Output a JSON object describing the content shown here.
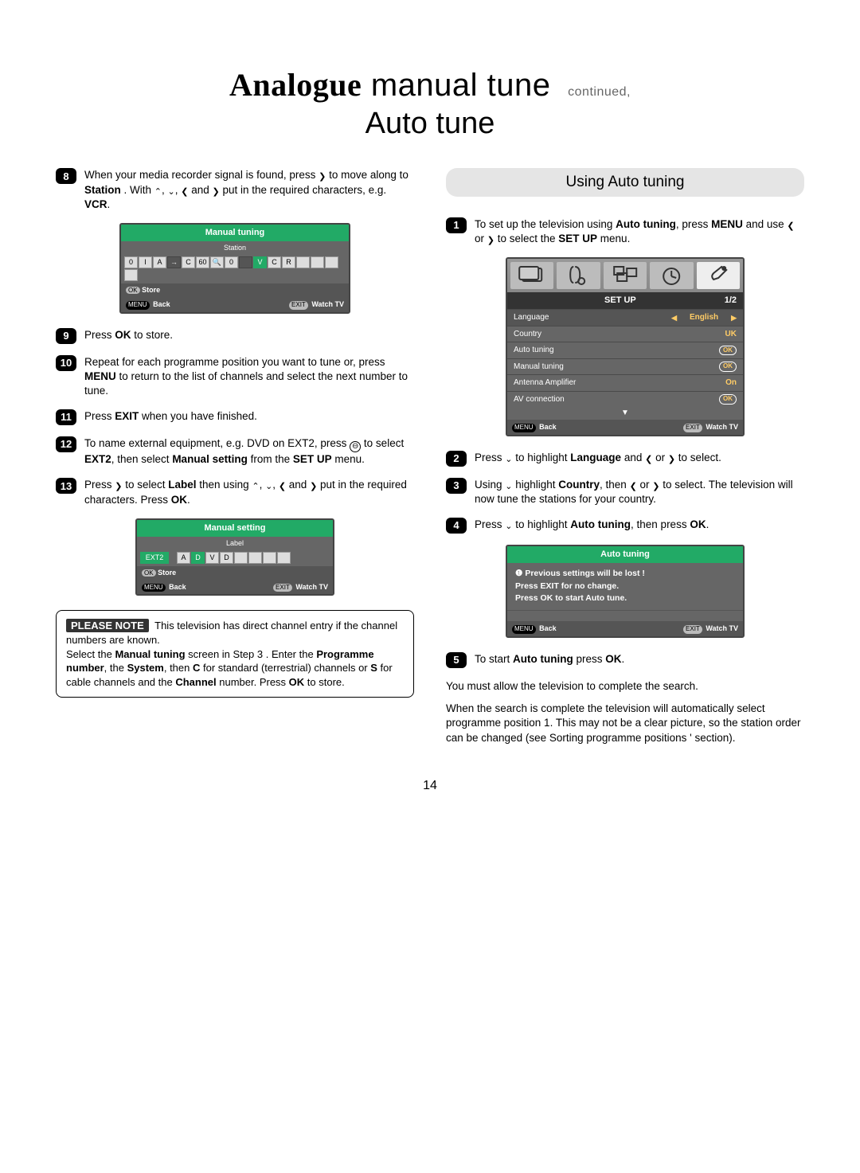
{
  "title": {
    "strong": "Analogue",
    "rest": " manual tune",
    "continued": "continued,",
    "line2": "Auto tune"
  },
  "left": {
    "step8": {
      "num": "8",
      "text_a": "When your media recorder signal is found, press ",
      "text_b": " to move along to ",
      "station": "Station",
      "text_c": ". With ",
      "text_d": " and ",
      "text_e": " put in the required characters,  e.g. ",
      "vcr": "VCR",
      "period": "."
    },
    "osd1": {
      "title": "Manual tuning",
      "sub": "Station",
      "cells": [
        "0",
        "I",
        "A",
        "→",
        "C",
        "60",
        "🔍",
        "0",
        "",
        "V",
        "C",
        "R",
        "",
        "",
        "",
        ""
      ],
      "store": "Store",
      "ok": "OK",
      "menu": "MENU",
      "back": "Back",
      "exit": "EXIT",
      "watch": "Watch TV"
    },
    "step9": {
      "num": "9",
      "a": "Press ",
      "b": "OK",
      "c": " to store."
    },
    "step10": {
      "num": "10",
      "a": "Repeat for each  programme position    you want to tune or, press ",
      "b": "MENU",
      "c": " to return to the list of channels and select the next number to tune."
    },
    "step11": {
      "num": "11",
      "a": "Press ",
      "b": "EXIT",
      "c": " when you have finished."
    },
    "step12": {
      "num": "12",
      "a": "To name external equipment,  e.g. DVD on EXT2, press ",
      "b": " to select ",
      "c": "EXT2",
      "d": ", then select ",
      "e": "Manual setting",
      "f": " from the ",
      "g": "SET UP",
      "h": " menu."
    },
    "step13": {
      "num": "13",
      "a": "Press ",
      "b": " to select ",
      "c": "Label",
      "d": " then using ",
      "e": " and ",
      "f": " put in the required characters. Press ",
      "g": "OK",
      "h": "."
    },
    "osd2": {
      "title": "Manual setting",
      "sub": "Label",
      "ext": "EXT2",
      "cells": [
        "A",
        "D",
        "V",
        "D",
        "",
        "",
        "",
        ""
      ],
      "ok": "OK",
      "store": "Store",
      "menu": "MENU",
      "back": "Back",
      "exit": "EXIT",
      "watch": "Watch TV"
    },
    "note": {
      "badge": "PLEASE NOTE",
      "a": "This television has direct channel entry if the channel numbers are known.",
      "b1": "Select the ",
      "b2": "Manual tuning",
      "b3": " screen in Step 3 . Enter the ",
      "c1": "Programme number",
      "c2": ", the ",
      "c3": "System",
      "c4": ", then ",
      "c5": "C",
      "c6": " for standard (terrestrial) channels or ",
      "c7": "S",
      "c8": " for cable channels and the ",
      "c9": "Channel",
      "c10": " number. Press ",
      "c11": "OK",
      "c12": " to store."
    }
  },
  "right": {
    "header": "Using Auto tuning",
    "step1": {
      "num": "1",
      "a": "To set up the television using ",
      "b": "Auto tuning",
      "c": ", press ",
      "d": "MENU",
      "e": " and use ",
      "f": " or ",
      "g": " to select the ",
      "h": "SET UP",
      "i": " menu."
    },
    "setup": {
      "title": "SET UP",
      "page": "1/2",
      "rows": [
        {
          "label": "Language",
          "val": "English",
          "type": "lr"
        },
        {
          "label": "Country",
          "val": "UK",
          "type": "plain"
        },
        {
          "label": "Auto tuning",
          "val": "OK",
          "type": "ok"
        },
        {
          "label": "Manual tuning",
          "val": "OK",
          "type": "ok"
        },
        {
          "label": "Antenna Amplifier",
          "val": "On",
          "type": "plain"
        },
        {
          "label": "AV connection",
          "val": "OK",
          "type": "ok"
        }
      ],
      "menu": "MENU",
      "back": "Back",
      "exit": "EXIT",
      "watch": "Watch TV"
    },
    "step2": {
      "num": "2",
      "a": "Press ",
      "b": " to highlight ",
      "c": "Language",
      "d": " and ",
      "e": " or ",
      "f": " to select."
    },
    "step3": {
      "num": "3",
      "a": "Using ",
      "b": " highlight ",
      "c": "Country",
      "d": ", then ",
      "e": " or ",
      "f": " to select. The television will now tune the stations for your country."
    },
    "step4": {
      "num": "4",
      "a": "Press ",
      "b": " to highlight ",
      "c": "Auto tuning",
      "d": ", then press ",
      "e": "OK",
      "f": "."
    },
    "auto": {
      "title": "Auto tuning",
      "l1": "Previous settings will be lost  !",
      "l2": "Press EXIT for no change.",
      "l3": "Press OK to start Auto tune.",
      "menu": "MENU",
      "back": "Back",
      "exit": "EXIT",
      "watch": "Watch TV"
    },
    "step5": {
      "num": "5",
      "a": "To start ",
      "b": "Auto tuning",
      "c": " press ",
      "d": "OK",
      "e": "."
    },
    "p1": "You must allow the television to complete the search.",
    "p2": "When the search is complete the television will automatically select programme position 1. This may not be a clear picture, so the station order can be changed (see Sorting programme positions ' section)."
  },
  "pagenum": "14"
}
